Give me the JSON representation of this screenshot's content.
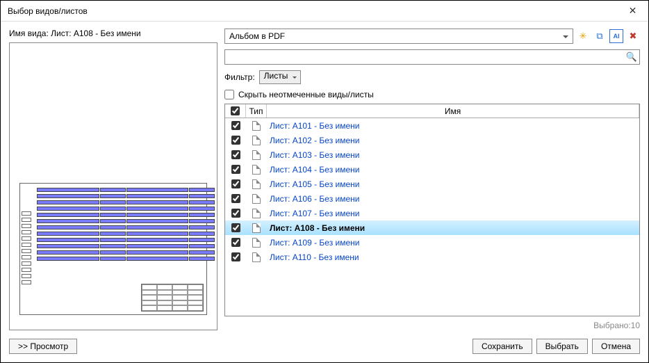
{
  "window": {
    "title": "Выбор видов/листов"
  },
  "left": {
    "viewname_label": "Имя вида: Лист: А108 - Без имени"
  },
  "right": {
    "combo_value": "Альбом в PDF",
    "icons": {
      "new": "new-set",
      "duplicate": "duplicate-set",
      "rename": "rename-set",
      "delete": "delete-set"
    },
    "search_placeholder": "",
    "filter_label": "Фильтр:",
    "filter_value": "Листы",
    "hide_unchecked_label": "Скрыть неотмеченные виды/листы",
    "hide_unchecked": false,
    "columns": {
      "type": "Тип",
      "name": "Имя"
    },
    "master_check": true,
    "rows": [
      {
        "checked": true,
        "name": "Лист: А101 - Без имени",
        "selected": false
      },
      {
        "checked": true,
        "name": "Лист: А102 - Без имени",
        "selected": false
      },
      {
        "checked": true,
        "name": "Лист: А103 - Без имени",
        "selected": false
      },
      {
        "checked": true,
        "name": "Лист: А104 - Без имени",
        "selected": false
      },
      {
        "checked": true,
        "name": "Лист: А105 - Без имени",
        "selected": false
      },
      {
        "checked": true,
        "name": "Лист: А106 - Без имени",
        "selected": false
      },
      {
        "checked": true,
        "name": "Лист: А107 - Без имени",
        "selected": false
      },
      {
        "checked": true,
        "name": "Лист: А108 - Без имени",
        "selected": true
      },
      {
        "checked": true,
        "name": "Лист: А109 - Без имени",
        "selected": false
      },
      {
        "checked": true,
        "name": "Лист: А110 - Без имени",
        "selected": false
      }
    ],
    "selected_count_label": "Выбрано:10"
  },
  "buttons": {
    "preview": ">> Просмотр",
    "save": "Сохранить",
    "select": "Выбрать",
    "cancel": "Отмена"
  }
}
